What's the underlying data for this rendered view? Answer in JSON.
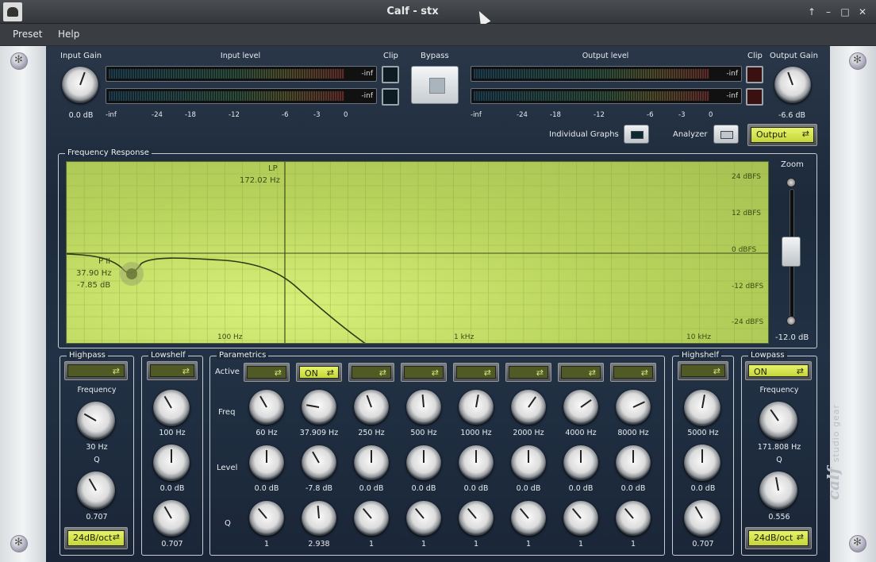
{
  "window": {
    "title": "Calf - stx"
  },
  "menu": [
    {
      "label": "Preset"
    },
    {
      "label": "Help"
    }
  ],
  "top": {
    "input_gain": {
      "label": "Input Gain",
      "value": "0.0 dB",
      "knob_angle": 200
    },
    "input_level": {
      "label": "Input level",
      "meters": [
        "-inf",
        "-inf"
      ]
    },
    "clip_label": "Clip",
    "bypass_label": "Bypass",
    "output_level": {
      "label": "Output level",
      "meters": [
        "-inf",
        "-inf"
      ]
    },
    "output_gain": {
      "label": "Output Gain",
      "value": "-6.6 dB",
      "knob_angle": 160
    },
    "scale": [
      "-inf",
      "-24",
      "-18",
      "-12",
      "-6",
      "-3",
      "0"
    ],
    "individual_graphs_label": "Individual Graphs",
    "analyzer_label": "Analyzer",
    "analyzer_mode": "Output"
  },
  "freq": {
    "legend": "Frequency Response",
    "db_labels": [
      "24 dBFS",
      "12 dBFS",
      "0 dBFS",
      "-12 dBFS",
      "-24 dBFS"
    ],
    "freq_labels": [
      "100 Hz",
      "1 kHz",
      "10 kHz"
    ],
    "lp_label": "LP",
    "lp_freq": "172.02 Hz",
    "p_label": "P II",
    "p_freq": "37.90 Hz",
    "p_level": "-7.85 dB",
    "zoom_label": "Zoom",
    "zoom_value": "-12.0 dB"
  },
  "highpass": {
    "legend": "Highpass",
    "freq_label": "Frequency",
    "freq": "30 Hz",
    "q_label": "Q",
    "q": "0.707",
    "mode": "24dB/oct",
    "freq_angle": 120,
    "q_angle": 150
  },
  "lowshelf": {
    "legend": "Lowshelf",
    "freq": "100 Hz",
    "level": "0.0 dB",
    "q": "0.707"
  },
  "parametrics": {
    "legend": "Parametrics",
    "row_active": "Active",
    "row_freq": "Freq",
    "row_level": "Level",
    "row_q": "Q",
    "bands": [
      {
        "active": "",
        "freq": "60 Hz",
        "level": "0.0 dB",
        "q": "1"
      },
      {
        "active": "ON",
        "freq": "37.909 Hz",
        "level": "-7.8 dB",
        "q": "2.938"
      },
      {
        "active": "",
        "freq": "250 Hz",
        "level": "0.0 dB",
        "q": "1"
      },
      {
        "active": "",
        "freq": "500 Hz",
        "level": "0.0 dB",
        "q": "1"
      },
      {
        "active": "",
        "freq": "1000 Hz",
        "level": "0.0 dB",
        "q": "1"
      },
      {
        "active": "",
        "freq": "2000 Hz",
        "level": "0.0 dB",
        "q": "1"
      },
      {
        "active": "",
        "freq": "4000 Hz",
        "level": "0.0 dB",
        "q": "1"
      },
      {
        "active": "",
        "freq": "8000 Hz",
        "level": "0.0 dB",
        "q": "1"
      }
    ]
  },
  "highshelf": {
    "legend": "Highshelf",
    "freq": "5000 Hz",
    "level": "0.0 dB",
    "q": "0.707"
  },
  "lowpass": {
    "legend": "Lowpass",
    "active": "ON",
    "freq_label": "Frequency",
    "freq": "171.808 Hz",
    "q_label": "Q",
    "q": "0.556",
    "mode": "24dB/oct"
  },
  "brand": {
    "name": "calf",
    "tagline": "studio gear"
  },
  "colors": {
    "accent": "#d4e64a",
    "panel": "#1f2c3e"
  }
}
